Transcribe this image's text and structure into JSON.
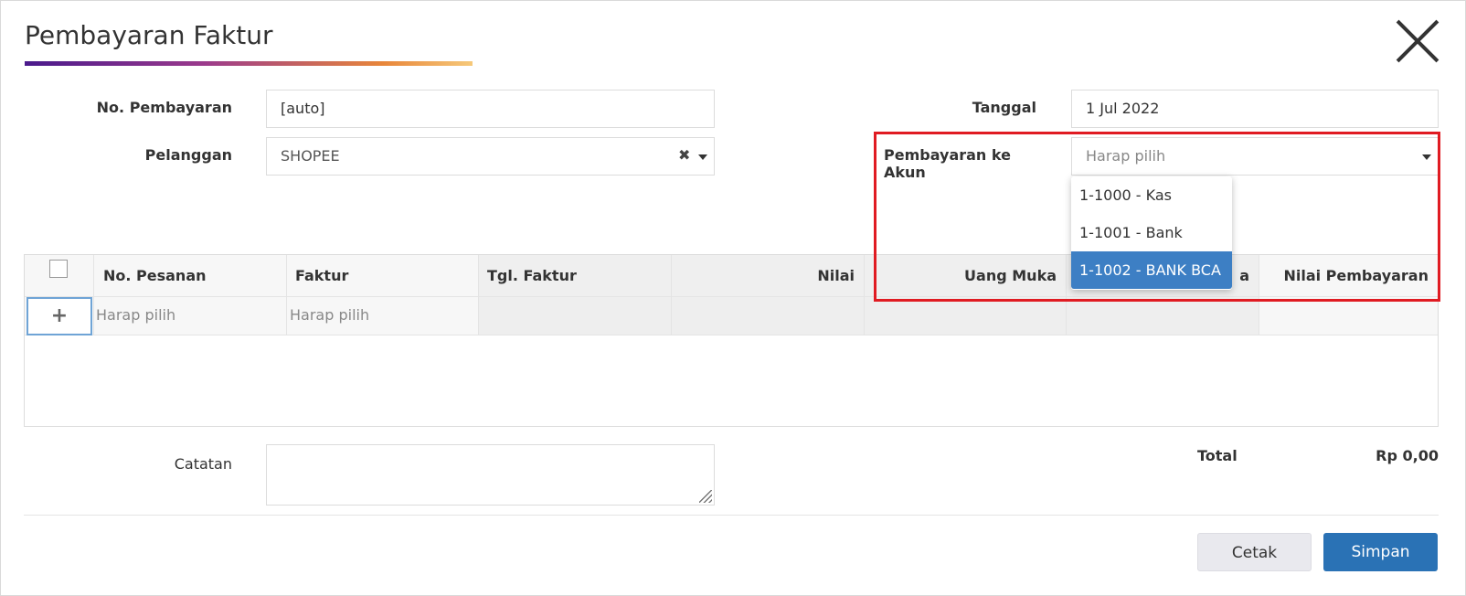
{
  "dialog": {
    "title": "Pembayaran Faktur"
  },
  "form": {
    "no_pembayaran_label": "No. Pembayaran",
    "no_pembayaran_value": "[auto]",
    "pelanggan_label": "Pelanggan",
    "pelanggan_value": "SHOPEE",
    "tanggal_label": "Tanggal",
    "tanggal_value": "1 Jul 2022",
    "akun_label": "Pembayaran ke Akun",
    "akun_placeholder": "Harap pilih",
    "clear_glyph": "✖"
  },
  "akun_dropdown": {
    "options": [
      {
        "label": "1-1000 - Kas",
        "selected": false
      },
      {
        "label": "1-1001 - Bank",
        "selected": false
      },
      {
        "label": "1-1002 - BANK BCA",
        "selected": true
      }
    ]
  },
  "table": {
    "columns": [
      {
        "label": ""
      },
      {
        "label": "No. Pesanan"
      },
      {
        "label": "Faktur"
      },
      {
        "label": "Tgl. Faktur"
      },
      {
        "label": "Nilai"
      },
      {
        "label": "Uang Muka"
      },
      {
        "label": "a"
      },
      {
        "label": "Nilai Pembayaran"
      }
    ],
    "add_row_glyph": "+",
    "row_placeholders": {
      "no_pesanan": "Harap pilih",
      "faktur": "Harap pilih"
    }
  },
  "catatan_label": "Catatan",
  "summary": {
    "total_label": "Total",
    "total_value": "Rp 0,00"
  },
  "footer": {
    "cetak_label": "Cetak",
    "simpan_label": "Simpan"
  },
  "colors": {
    "highlight": "#e01b22",
    "primary": "#2a72b5",
    "selected_option": "#3d7fc4"
  }
}
